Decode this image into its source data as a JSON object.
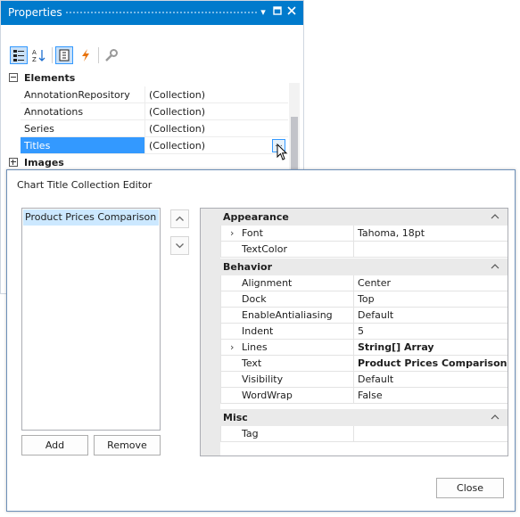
{
  "properties": {
    "title": "Properties",
    "elements_category": "Elements",
    "images_category": "Images",
    "rows": [
      {
        "name": "AnnotationRepository",
        "value": "(Collection)"
      },
      {
        "name": "Annotations",
        "value": "(Collection)"
      },
      {
        "name": "Series",
        "value": "(Collection)"
      },
      {
        "name": "Titles",
        "value": "(Collection)"
      }
    ],
    "ellipsis": "..."
  },
  "dialog": {
    "title": "Chart Title Collection Editor",
    "list_items": [
      "Product Prices Comparison"
    ],
    "add_label": "Add",
    "remove_label": "Remove",
    "close_label": "Close",
    "grid": {
      "appearance": "Appearance",
      "behavior": "Behavior",
      "misc": "Misc",
      "rows": [
        {
          "name": "Font",
          "value": "Tahoma, 18pt"
        },
        {
          "name": "TextColor",
          "value": ""
        },
        {
          "name": "Alignment",
          "value": "Center"
        },
        {
          "name": "Dock",
          "value": "Top"
        },
        {
          "name": "EnableAntialiasing",
          "value": "Default"
        },
        {
          "name": "Indent",
          "value": "5"
        },
        {
          "name": "Lines",
          "value": "String[] Array"
        },
        {
          "name": "Text",
          "value": "Product Prices Comparison"
        },
        {
          "name": "Visibility",
          "value": "Default"
        },
        {
          "name": "WordWrap",
          "value": "False"
        },
        {
          "name": "Tag",
          "value": ""
        }
      ]
    }
  },
  "colors": {
    "titlebar": "#007acc",
    "selection": "#3399ff",
    "list_selection": "#cce8ff",
    "category_bg": "#eaeaea"
  },
  "icons": [
    "categorized-icon",
    "alphabetical-icon",
    "properties-icon",
    "events-icon",
    "wrench-icon",
    "dropdown-icon",
    "pin-icon",
    "close-icon",
    "up-arrow-icon",
    "down-arrow-icon",
    "expand-arrow-icon",
    "collapse-caret-icon",
    "cursor-icon"
  ]
}
